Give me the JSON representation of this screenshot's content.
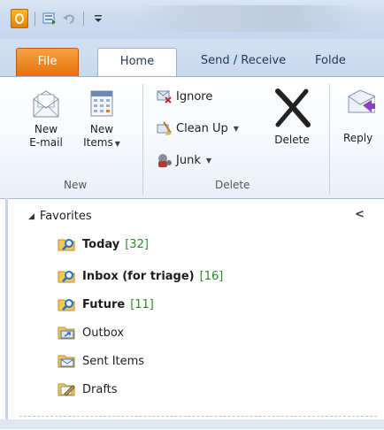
{
  "quick_access": {
    "app_icon": "outlook-icon",
    "buttons": [
      "send-receive-all-icon",
      "undo-icon",
      "customize-quick-access-icon"
    ]
  },
  "tabs": [
    {
      "label": "File",
      "selected": false
    },
    {
      "label": "Home",
      "selected": true
    },
    {
      "label": "Send / Receive",
      "selected": false
    },
    {
      "label": "Folde",
      "selected": false
    }
  ],
  "ribbon": {
    "new_group": {
      "label": "New",
      "new_email": {
        "line1": "New",
        "line2": "E-mail",
        "icon": "new-email-icon"
      },
      "new_items": {
        "line1": "New",
        "line2": "Items",
        "icon": "new-items-icon"
      }
    },
    "delete_group": {
      "label": "Delete",
      "ignore": {
        "label": "Ignore",
        "icon": "ignore-icon"
      },
      "clean_up": {
        "label": "Clean Up",
        "icon": "clean-up-icon"
      },
      "junk": {
        "label": "Junk",
        "icon": "junk-icon"
      },
      "delete": {
        "label": "Delete",
        "icon": "delete-x-icon"
      }
    },
    "respond_group": {
      "reply": {
        "label": "Reply",
        "icon": "reply-icon"
      }
    }
  },
  "folder_pane": {
    "section_label": "Favorites",
    "collapse_glyph": "<",
    "folders": [
      {
        "name": "Today",
        "count": "[32]",
        "bold": true,
        "icon": "search-folder-icon"
      },
      {
        "name": "Inbox (for triage)",
        "count": "[16]",
        "bold": true,
        "icon": "search-folder-icon"
      },
      {
        "name": "Future",
        "count": "[11]",
        "bold": true,
        "icon": "search-folder-icon"
      },
      {
        "name": "Outbox",
        "count": "",
        "bold": false,
        "icon": "outbox-icon"
      },
      {
        "name": "Sent Items",
        "count": "",
        "bold": false,
        "icon": "sent-items-icon"
      },
      {
        "name": "Drafts",
        "count": "",
        "bold": false,
        "icon": "drafts-icon"
      }
    ]
  },
  "colors": {
    "file_tab": "#e87208",
    "unread_count": "#2a8a2a",
    "ribbon_border": "#9db2cc"
  }
}
